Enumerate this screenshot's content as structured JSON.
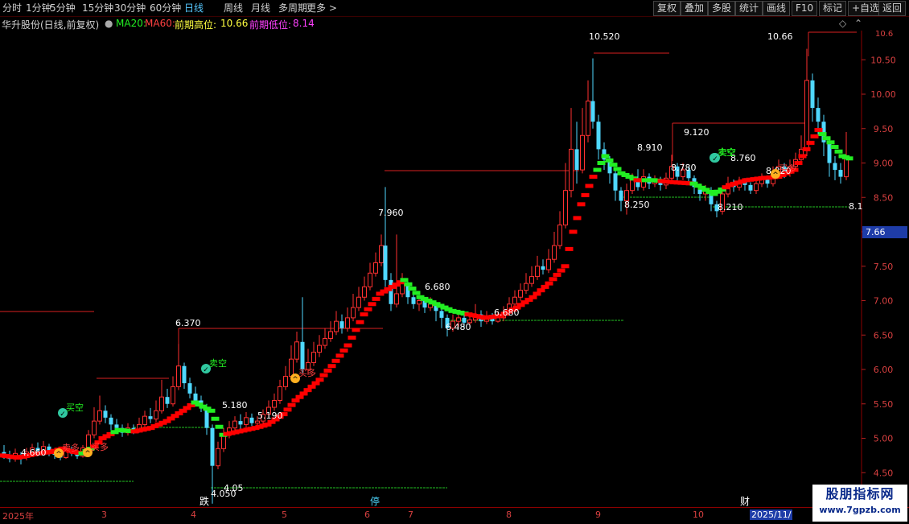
{
  "toolbar": {
    "periods": [
      "分时",
      "1分钟",
      "5分钟",
      "15分钟",
      "30分钟",
      "60分钟",
      "日线",
      "周线",
      "月线",
      "多周期",
      "更多 >"
    ],
    "active_period": "日线",
    "right_buttons": [
      "复权",
      "叠加",
      "多股",
      "统计",
      "画线",
      "F10",
      "标记",
      "+自选",
      "返回"
    ]
  },
  "infobar": {
    "stock": "华升股份(日线,前复权)",
    "ma20": "MA20:",
    "ma60": "MA60:",
    "high_label": "前期高位:",
    "high_value": "10.66",
    "low_label": "前期低位:",
    "low_value": "8.14"
  },
  "colors": {
    "up": "#ff3030",
    "down": "#4fd8ff",
    "ma_up": "#ff0000",
    "ma_down": "#22ee22",
    "support": "#22c022",
    "grid": "#8b0000"
  },
  "price_axis": {
    "ticks": [
      "10.50",
      "10.00",
      "9.50",
      "9.00",
      "8.50",
      "8.00",
      "7.50",
      "7.00",
      "6.50",
      "6.00",
      "5.50",
      "5.00",
      "4.50"
    ],
    "current": "7.66",
    "cut_value": "10.6"
  },
  "time_axis": {
    "labels": [
      "2025年",
      "3",
      "4",
      "5",
      "6",
      "7",
      "8",
      "9",
      "10"
    ],
    "current": "2025/11/"
  },
  "annotations": {
    "price_labels": [
      "4.660",
      "6.370",
      "5.180",
      "5.190",
      "7.960",
      "6.680",
      "6.480",
      "6.680",
      "10.520",
      "8.910",
      "8.780",
      "8.250",
      "9.120",
      "8.760",
      "8.820",
      "8.210",
      "10.66",
      "4.050",
      "4.05",
      "8.1"
    ],
    "signals": [
      "买空",
      "卖多",
      "买多",
      "卖空",
      "买多",
      "卖空",
      "卖空",
      "买多"
    ],
    "events": [
      "跌",
      "停",
      "财"
    ]
  },
  "watermark": {
    "title": "股朋指标网",
    "url": "www.7gpzb.com"
  },
  "chart_data": {
    "type": "candlestick",
    "title": "华升股份(日线,前复权)",
    "ylim": [
      4.2,
      10.9
    ],
    "series": [
      {
        "name": "MA20",
        "color_up": "#ff0000",
        "color_down": "#22ee22"
      },
      {
        "name": "MA60"
      }
    ],
    "ma20_path": [
      [
        0,
        4.75
      ],
      [
        20,
        4.72
      ],
      [
        45,
        4.78
      ],
      [
        60,
        4.8
      ],
      [
        75,
        4.85
      ],
      [
        90,
        4.8
      ],
      [
        100,
        4.78
      ],
      [
        115,
        4.88
      ],
      [
        125,
        5.0
      ],
      [
        145,
        5.12
      ],
      [
        165,
        5.1
      ],
      [
        185,
        5.15
      ],
      [
        205,
        5.25
      ],
      [
        225,
        5.4
      ],
      [
        240,
        5.52
      ],
      [
        260,
        5.4
      ],
      [
        275,
        5.05
      ],
      [
        295,
        5.1
      ],
      [
        315,
        5.15
      ],
      [
        330,
        5.2
      ],
      [
        350,
        5.35
      ],
      [
        365,
        5.55
      ],
      [
        380,
        5.7
      ],
      [
        395,
        5.85
      ],
      [
        410,
        6.05
      ],
      [
        430,
        6.35
      ],
      [
        450,
        6.8
      ],
      [
        470,
        7.1
      ],
      [
        485,
        7.2
      ],
      [
        500,
        7.3
      ],
      [
        520,
        7.05
      ],
      [
        540,
        6.95
      ],
      [
        560,
        6.85
      ],
      [
        580,
        6.8
      ],
      [
        600,
        6.75
      ],
      [
        620,
        6.78
      ],
      [
        640,
        6.9
      ],
      [
        660,
        7.05
      ],
      [
        680,
        7.25
      ],
      [
        700,
        7.5
      ],
      [
        710,
        8.0
      ],
      [
        720,
        8.4
      ],
      [
        735,
        8.8
      ],
      [
        750,
        9.1
      ],
      [
        770,
        8.85
      ],
      [
        790,
        8.75
      ],
      [
        810,
        8.75
      ],
      [
        835,
        8.72
      ],
      [
        860,
        8.7
      ],
      [
        885,
        8.55
      ],
      [
        905,
        8.68
      ],
      [
        925,
        8.75
      ],
      [
        945,
        8.78
      ],
      [
        965,
        8.8
      ],
      [
        985,
        8.9
      ],
      [
        1000,
        9.2
      ],
      [
        1015,
        9.48
      ],
      [
        1030,
        9.3
      ],
      [
        1045,
        9.1
      ],
      [
        1058,
        9.05
      ]
    ],
    "ma20_down_segments": [
      [
        100,
        115
      ],
      [
        140,
        165
      ],
      [
        240,
        280
      ],
      [
        500,
        580
      ],
      [
        740,
        790
      ],
      [
        800,
        820
      ],
      [
        860,
        900
      ],
      [
        1018,
        1055
      ]
    ],
    "candles": [
      [
        5,
        4.8,
        4.75,
        4.9,
        4.7
      ],
      [
        12,
        4.75,
        4.7,
        4.82,
        4.65
      ],
      [
        19,
        4.7,
        4.78,
        4.85,
        4.66
      ],
      [
        26,
        4.76,
        4.7,
        4.8,
        4.62
      ],
      [
        33,
        4.72,
        4.8,
        4.86,
        4.68
      ],
      [
        40,
        4.8,
        4.86,
        4.92,
        4.75
      ],
      [
        47,
        4.86,
        4.82,
        4.94,
        4.78
      ],
      [
        54,
        4.82,
        4.88,
        4.96,
        4.8
      ],
      [
        61,
        4.88,
        4.8,
        4.92,
        4.74
      ],
      [
        68,
        4.8,
        4.76,
        4.84,
        4.7
      ],
      [
        75,
        4.76,
        4.72,
        4.8,
        4.68
      ],
      [
        82,
        4.72,
        4.82,
        4.86,
        4.7
      ],
      [
        89,
        4.82,
        4.78,
        4.88,
        4.74
      ],
      [
        96,
        4.78,
        4.74,
        4.82,
        4.7
      ],
      [
        103,
        4.74,
        4.86,
        4.9,
        4.72
      ],
      [
        110,
        4.86,
        5.05,
        5.12,
        4.82
      ],
      [
        117,
        5.05,
        5.25,
        5.45,
        5.0
      ],
      [
        124,
        5.25,
        5.4,
        5.62,
        5.2
      ],
      [
        131,
        5.4,
        5.3,
        5.48,
        5.22
      ],
      [
        138,
        5.3,
        5.2,
        5.35,
        5.12
      ],
      [
        145,
        5.2,
        5.15,
        5.28,
        5.1
      ],
      [
        152,
        5.15,
        5.08,
        5.2,
        5.02
      ],
      [
        159,
        5.08,
        5.15,
        5.22,
        5.04
      ],
      [
        166,
        5.15,
        5.12,
        5.2,
        5.06
      ],
      [
        173,
        5.12,
        5.2,
        5.3,
        5.08
      ],
      [
        180,
        5.2,
        5.32,
        5.4,
        5.16
      ],
      [
        187,
        5.32,
        5.28,
        5.44,
        5.22
      ],
      [
        194,
        5.28,
        5.4,
        5.55,
        5.24
      ],
      [
        201,
        5.4,
        5.6,
        5.85,
        5.36
      ],
      [
        208,
        5.6,
        5.5,
        5.72,
        5.44
      ],
      [
        215,
        5.5,
        5.75,
        5.9,
        5.46
      ],
      [
        222,
        5.75,
        6.05,
        6.37,
        5.7
      ],
      [
        229,
        6.05,
        5.8,
        6.1,
        5.72
      ],
      [
        236,
        5.8,
        5.65,
        5.88,
        5.58
      ],
      [
        243,
        5.65,
        5.55,
        5.75,
        5.48
      ],
      [
        250,
        5.55,
        5.45,
        5.62,
        5.38
      ],
      [
        257,
        5.45,
        5.15,
        5.5,
        5.05
      ],
      [
        264,
        5.15,
        4.6,
        5.2,
        4.05
      ],
      [
        271,
        4.6,
        4.85,
        4.95,
        4.55
      ],
      [
        278,
        4.85,
        5.05,
        5.15,
        4.8
      ],
      [
        285,
        5.05,
        5.15,
        5.25,
        5.0
      ],
      [
        292,
        5.15,
        5.25,
        5.32,
        5.08
      ],
      [
        299,
        5.25,
        5.2,
        5.35,
        5.12
      ],
      [
        306,
        5.2,
        5.3,
        5.38,
        5.15
      ],
      [
        313,
        5.3,
        5.22,
        5.36,
        5.18
      ],
      [
        320,
        5.22,
        5.25,
        5.32,
        5.19
      ],
      [
        327,
        5.25,
        5.35,
        5.42,
        5.2
      ],
      [
        334,
        5.35,
        5.45,
        5.55,
        5.3
      ],
      [
        341,
        5.45,
        5.55,
        5.65,
        5.4
      ],
      [
        348,
        5.55,
        5.75,
        5.85,
        5.5
      ],
      [
        355,
        5.75,
        5.9,
        6.05,
        5.7
      ],
      [
        362,
        5.9,
        6.15,
        6.35,
        5.85
      ],
      [
        369,
        6.15,
        6.4,
        6.55,
        6.1
      ],
      [
        376,
        6.4,
        6.0,
        7.05,
        5.95
      ],
      [
        383,
        6.0,
        6.1,
        6.3,
        5.92
      ],
      [
        390,
        6.1,
        6.25,
        6.4,
        6.05
      ],
      [
        397,
        6.25,
        6.35,
        6.5,
        6.18
      ],
      [
        404,
        6.35,
        6.45,
        6.6,
        6.3
      ],
      [
        411,
        6.45,
        6.55,
        6.7,
        6.4
      ],
      [
        418,
        6.55,
        6.7,
        6.85,
        6.5
      ],
      [
        425,
        6.7,
        6.6,
        6.8,
        6.52
      ],
      [
        432,
        6.6,
        6.75,
        6.9,
        6.55
      ],
      [
        439,
        6.75,
        6.9,
        7.1,
        6.7
      ],
      [
        446,
        6.9,
        7.05,
        7.2,
        6.85
      ],
      [
        453,
        7.05,
        7.2,
        7.35,
        7.0
      ],
      [
        460,
        7.2,
        7.4,
        7.55,
        7.15
      ],
      [
        467,
        7.4,
        7.55,
        7.7,
        7.35
      ],
      [
        474,
        7.55,
        7.8,
        7.96,
        7.5
      ],
      [
        479,
        7.8,
        7.3,
        8.65,
        7.2
      ],
      [
        486,
        7.3,
        6.95,
        7.4,
        6.85
      ],
      [
        493,
        6.95,
        7.1,
        7.96,
        6.9
      ],
      [
        500,
        7.1,
        7.25,
        7.4,
        7.05
      ],
      [
        507,
        7.25,
        7.05,
        7.3,
        6.95
      ],
      [
        514,
        7.05,
        6.95,
        7.1,
        6.88
      ],
      [
        521,
        6.95,
        7.0,
        7.08,
        6.85
      ],
      [
        528,
        7.0,
        6.9,
        7.05,
        6.82
      ],
      [
        535,
        6.9,
        6.95,
        7.05,
        6.85
      ],
      [
        542,
        6.95,
        6.85,
        7.0,
        6.7
      ],
      [
        549,
        6.85,
        6.75,
        6.92,
        6.6
      ],
      [
        556,
        6.75,
        6.6,
        6.8,
        6.48
      ],
      [
        563,
        6.6,
        6.7,
        6.8,
        6.55
      ],
      [
        570,
        6.7,
        6.75,
        6.85,
        6.62
      ],
      [
        577,
        6.75,
        6.68,
        6.82,
        6.6
      ],
      [
        584,
        6.68,
        6.72,
        6.8,
        6.62
      ],
      [
        591,
        6.72,
        6.8,
        6.95,
        6.68
      ],
      [
        598,
        6.8,
        6.7,
        6.86,
        6.62
      ],
      [
        605,
        6.7,
        6.78,
        6.85,
        6.66
      ],
      [
        612,
        6.78,
        6.7,
        6.82,
        6.65
      ],
      [
        619,
        6.7,
        6.75,
        6.85,
        6.68
      ],
      [
        626,
        6.75,
        6.82,
        6.92,
        6.7
      ],
      [
        633,
        6.82,
        6.95,
        7.05,
        6.78
      ],
      [
        640,
        6.95,
        7.05,
        7.15,
        6.9
      ],
      [
        647,
        7.05,
        7.15,
        7.25,
        7.0
      ],
      [
        654,
        7.15,
        7.25,
        7.4,
        7.1
      ],
      [
        661,
        7.25,
        7.35,
        7.5,
        7.2
      ],
      [
        668,
        7.35,
        7.5,
        7.65,
        7.3
      ],
      [
        675,
        7.5,
        7.45,
        7.6,
        7.38
      ],
      [
        682,
        7.45,
        7.6,
        7.75,
        7.4
      ],
      [
        689,
        7.6,
        7.8,
        8.0,
        7.55
      ],
      [
        696,
        7.8,
        8.1,
        8.3,
        7.75
      ],
      [
        703,
        8.1,
        8.6,
        9.0,
        8.05
      ],
      [
        710,
        8.6,
        9.2,
        9.8,
        8.5
      ],
      [
        717,
        9.2,
        8.9,
        9.6,
        8.7
      ],
      [
        724,
        8.9,
        9.4,
        9.8,
        8.85
      ],
      [
        731,
        9.4,
        9.9,
        10.2,
        9.3
      ],
      [
        737,
        9.9,
        9.6,
        10.52,
        9.5
      ],
      [
        744,
        9.6,
        9.2,
        9.7,
        9.05
      ],
      [
        751,
        9.2,
        9.05,
        9.3,
        8.9
      ],
      [
        758,
        9.05,
        8.85,
        9.1,
        8.7
      ],
      [
        765,
        8.85,
        8.6,
        8.9,
        8.45
      ],
      [
        772,
        8.6,
        8.45,
        8.65,
        8.3
      ],
      [
        779,
        8.45,
        8.6,
        8.7,
        8.25
      ],
      [
        786,
        8.6,
        8.75,
        8.85,
        8.55
      ],
      [
        793,
        8.75,
        8.65,
        8.91,
        8.6
      ],
      [
        800,
        8.65,
        8.8,
        8.91,
        8.6
      ],
      [
        807,
        8.8,
        8.7,
        8.85,
        8.62
      ],
      [
        814,
        8.7,
        8.75,
        8.82,
        8.65
      ],
      [
        821,
        8.75,
        8.68,
        8.8,
        8.6
      ],
      [
        828,
        8.68,
        8.78,
        8.86,
        8.62
      ],
      [
        835,
        8.78,
        8.95,
        9.12,
        8.7
      ],
      [
        842,
        8.95,
        8.8,
        9.0,
        8.72
      ],
      [
        849,
        8.8,
        8.9,
        9.0,
        8.75
      ],
      [
        856,
        8.9,
        8.78,
        8.95,
        8.7
      ],
      [
        863,
        8.78,
        8.65,
        8.82,
        8.55
      ],
      [
        870,
        8.65,
        8.55,
        8.7,
        8.45
      ],
      [
        877,
        8.55,
        8.6,
        8.68,
        8.45
      ],
      [
        884,
        8.6,
        8.4,
        8.65,
        8.3
      ],
      [
        891,
        8.4,
        8.3,
        8.45,
        8.21
      ],
      [
        898,
        8.3,
        8.55,
        8.62,
        8.25
      ],
      [
        905,
        8.55,
        8.7,
        8.8,
        8.5
      ],
      [
        912,
        8.7,
        8.65,
        8.76,
        8.58
      ],
      [
        919,
        8.65,
        8.72,
        8.8,
        8.6
      ],
      [
        926,
        8.72,
        8.68,
        8.78,
        8.6
      ],
      [
        933,
        8.68,
        8.6,
        8.72,
        8.55
      ],
      [
        940,
        8.6,
        8.7,
        8.78,
        8.55
      ],
      [
        947,
        8.7,
        8.76,
        8.85,
        8.65
      ],
      [
        954,
        8.76,
        8.7,
        8.82,
        8.64
      ],
      [
        961,
        8.7,
        8.82,
        8.95,
        8.66
      ],
      [
        968,
        8.82,
        8.95,
        9.05,
        8.78
      ],
      [
        975,
        8.95,
        8.85,
        9.0,
        8.78
      ],
      [
        982,
        8.85,
        8.95,
        9.05,
        8.8
      ],
      [
        989,
        8.95,
        9.05,
        9.15,
        8.9
      ],
      [
        996,
        9.05,
        9.2,
        9.4,
        9.0
      ],
      [
        1003,
        9.2,
        10.2,
        10.66,
        9.1
      ],
      [
        1010,
        10.2,
        9.8,
        10.3,
        9.6
      ],
      [
        1017,
        9.8,
        9.6,
        9.95,
        9.4
      ],
      [
        1024,
        9.6,
        9.3,
        9.7,
        9.1
      ],
      [
        1031,
        9.3,
        9.0,
        9.35,
        8.8
      ],
      [
        1038,
        9.0,
        8.9,
        9.1,
        8.75
      ],
      [
        1045,
        8.9,
        8.8,
        9.0,
        8.7
      ],
      [
        1052,
        8.8,
        9.1,
        9.45,
        8.75
      ]
    ]
  }
}
